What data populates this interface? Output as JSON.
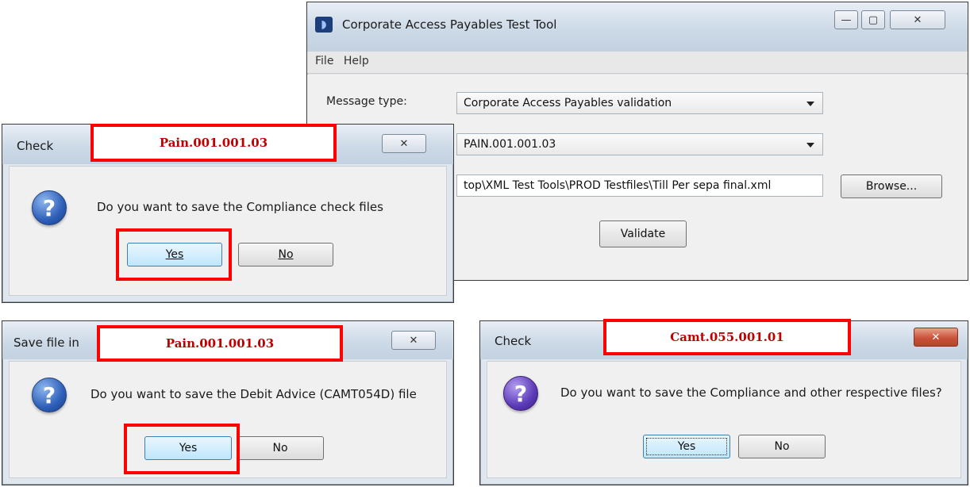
{
  "main_window": {
    "title": "Corporate Access Payables Test Tool",
    "menu": [
      "File",
      "Help"
    ],
    "message_type_label": "Message type:",
    "message_type_value": "Corporate Access Payables validation",
    "format_value": "PAIN.001.001.03",
    "file_path_value": "top\\XML Test Tools\\PROD Testfiles\\Till Per sepa final.xml",
    "browse_label": "Browse...",
    "validate_label": "Validate",
    "icons": {
      "minimize": "minimize-icon",
      "maximize": "maximize-icon",
      "close": "close-icon"
    }
  },
  "dialog_check_top": {
    "title": "Check",
    "annotation": "Pain.001.001.03",
    "message": "Do you want to save the Compliance check files",
    "yes_label": "Yes",
    "no_label": "No"
  },
  "dialog_save_file": {
    "title": "Save file in",
    "annotation": "Pain.001.001.03",
    "message": "Do you want to save the Debit Advice (CAMT054D) file",
    "yes_label": "Yes",
    "no_label": "No"
  },
  "dialog_check_right": {
    "title": "Check",
    "annotation": "Camt.055.001.01",
    "message": "Do you want to save the Compliance and other respective files?",
    "yes_label": "Yes",
    "no_label": "No"
  },
  "glyphs": {
    "close_x": "✕",
    "question": "?",
    "minimize": "—",
    "maximize": "▢",
    "app": "◗"
  }
}
